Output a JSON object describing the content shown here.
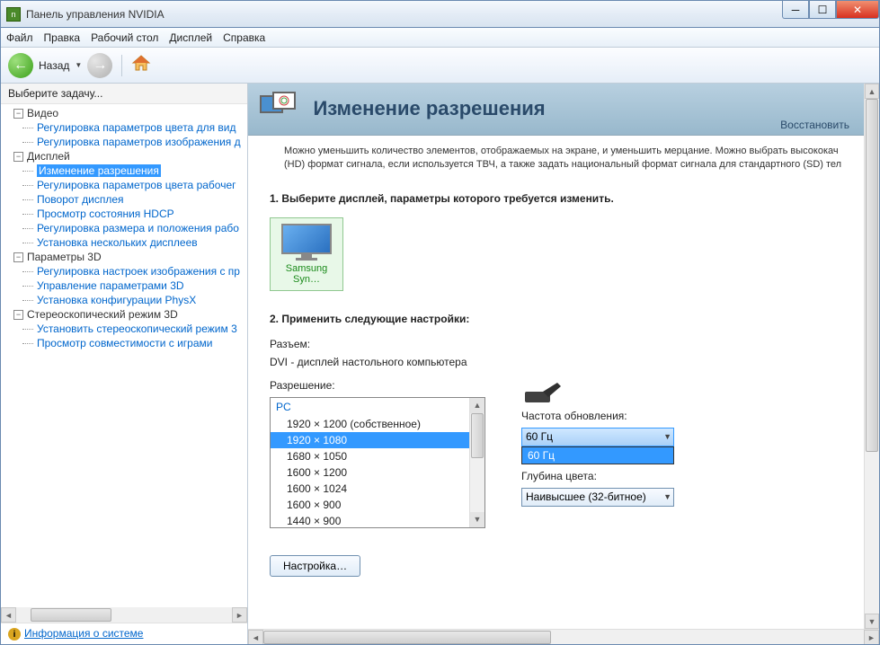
{
  "window": {
    "title": "Панель управления NVIDIA"
  },
  "menubar": [
    "Файл",
    "Правка",
    "Рабочий стол",
    "Дисплей",
    "Справка"
  ],
  "toolbar": {
    "back": "Назад"
  },
  "sidebar": {
    "header": "Выберите задачу...",
    "groups": [
      {
        "label": "Видео",
        "items": [
          "Регулировка параметров цвета для вид",
          "Регулировка параметров изображения д"
        ]
      },
      {
        "label": "Дисплей",
        "items": [
          "Изменение разрешения",
          "Регулировка параметров цвета рабочег",
          "Поворот дисплея",
          "Просмотр состояния HDCP",
          "Регулировка размера и положения рабо",
          "Установка нескольких дисплеев"
        ],
        "selectedIndex": 0
      },
      {
        "label": "Параметры 3D",
        "items": [
          "Регулировка настроек изображения с пр",
          "Управление параметрами 3D",
          "Установка конфигурации PhysX"
        ]
      },
      {
        "label": "Стереоскопический режим 3D",
        "items": [
          "Установить стереоскопический режим 3",
          "Просмотр совместимости с играми"
        ]
      }
    ],
    "footer": "Информация о системе"
  },
  "main": {
    "title": "Изменение разрешения",
    "restore": "Восстановить",
    "description": "Можно уменьшить количество элементов, отображаемых на экране, и уменьшить мерцание. Можно выбрать высококач (HD) формат сигнала, если используется ТВЧ, а также задать национальный формат сигнала для стандартного (SD) тел",
    "step1": {
      "title": "1. Выберите дисплей, параметры которого требуется изменить.",
      "display_name": "Samsung Syn…"
    },
    "step2": {
      "title": "2. Применить следующие настройки:",
      "connector_label": "Разъем:",
      "connector_value": "DVI - дисплей настольного компьютера",
      "resolution_label": "Разрешение:",
      "resolution_group": "PC",
      "resolutions": [
        "1920 × 1200 (собственное)",
        "1920 × 1080",
        "1680 × 1050",
        "1600 × 1200",
        "1600 × 1024",
        "1600 × 900",
        "1440 × 900"
      ],
      "resolution_selected": 1,
      "refresh_label": "Частота обновления:",
      "refresh_value": "60 Гц",
      "refresh_options": [
        "60 Гц"
      ],
      "depth_label": "Глубина цвета:",
      "depth_value": "Наивысшее (32-битное)",
      "customize": "Настройка…"
    }
  }
}
